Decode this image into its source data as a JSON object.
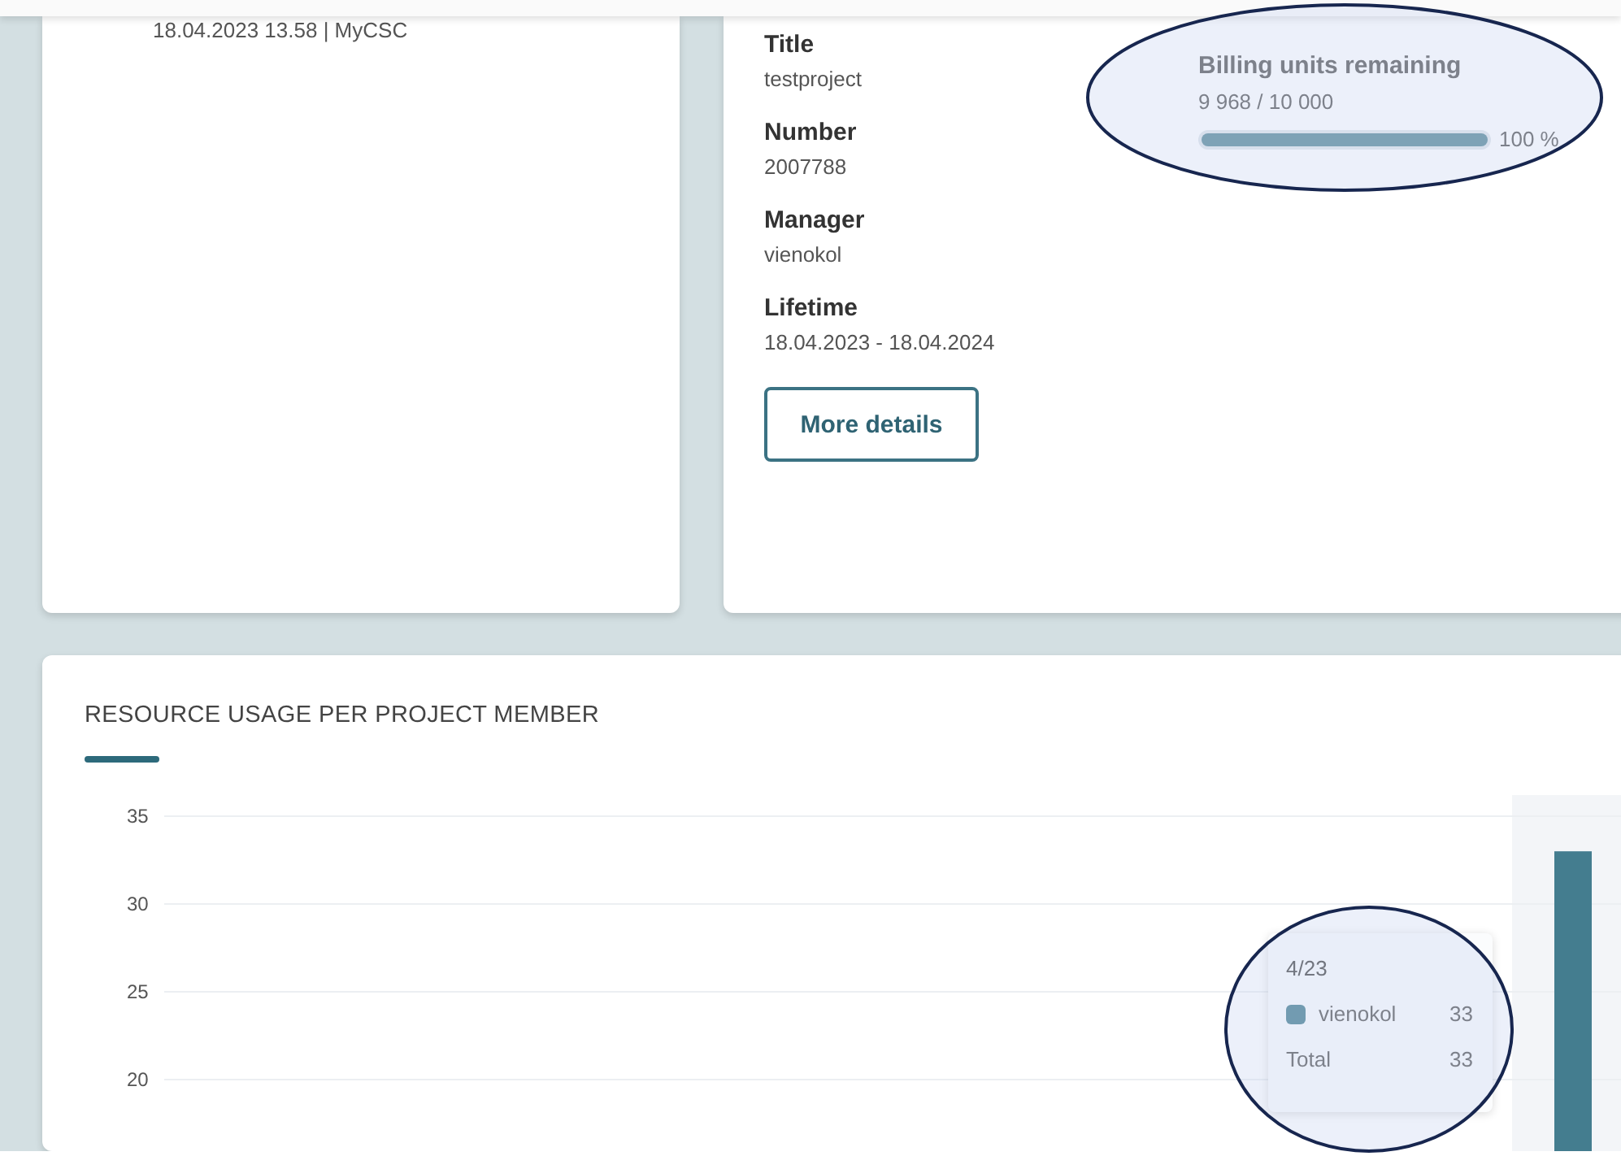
{
  "event_card": {
    "date_source": "18.04.2023 13.58 | MyCSC"
  },
  "project_card": {
    "fields": [
      {
        "label": "Title",
        "value": "testproject"
      },
      {
        "label": "Number",
        "value": "2007788"
      },
      {
        "label": "Manager",
        "value": "vienokol"
      },
      {
        "label": "Lifetime",
        "value": "18.04.2023 - 18.04.2024"
      }
    ],
    "button": "More details",
    "billing": {
      "title": "Billing units remaining",
      "amount": "9 968 / 10 000",
      "level": 1.0,
      "percent": "100 %"
    }
  },
  "usage_chart": {
    "title": "RESOURCE USAGE PER PROJECT MEMBER",
    "chart_data": {
      "type": "bar",
      "series": [
        {
          "name": "vienokol",
          "color": "#447d8f",
          "values": [
            33
          ]
        }
      ],
      "ylim": [
        14.9,
        35
      ],
      "yticks": [
        20,
        25,
        30,
        35
      ],
      "grid": true
    },
    "tooltip": {
      "heading": "4/23",
      "rows": [
        {
          "kind": "series",
          "value": "33"
        },
        {
          "kind": "total",
          "label": "Total",
          "value": "33"
        }
      ]
    }
  },
  "annotations": [
    {
      "kind": "ellipse"
    },
    {
      "kind": "ellipse"
    }
  ]
}
